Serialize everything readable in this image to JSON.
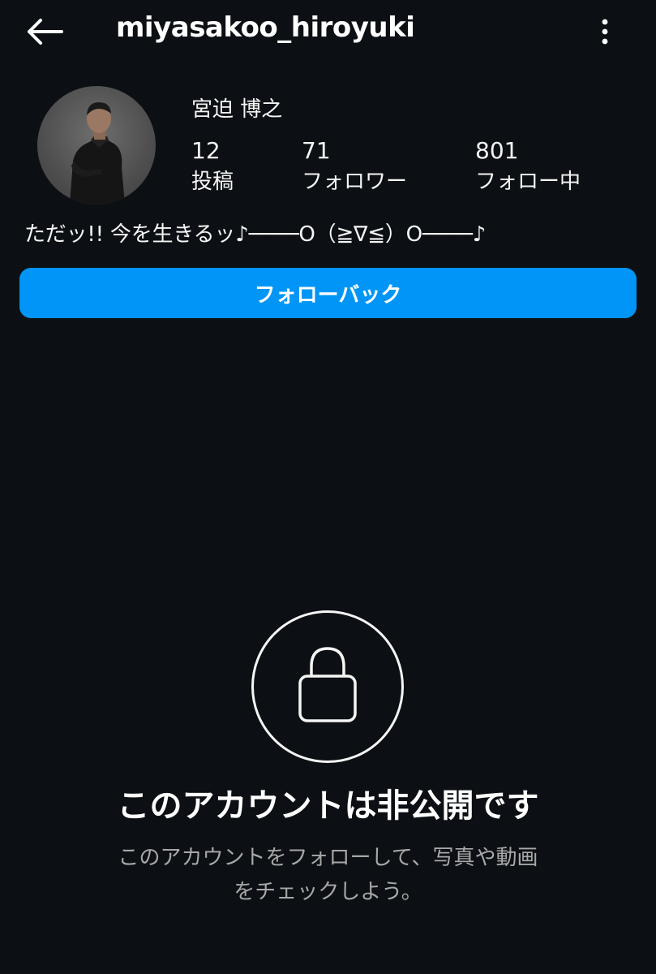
{
  "header": {
    "username": "miyasakoo_hiroyuki",
    "back_icon": "arrow-left-icon",
    "more_icon": "more-vertical-icon"
  },
  "profile": {
    "display_name": "宮迫 博之",
    "stats": {
      "posts": {
        "value": "12",
        "label": "投稿"
      },
      "followers": {
        "value": "71",
        "label": "フォロワー"
      },
      "following": {
        "value": "801",
        "label": "フォロー中"
      }
    },
    "bio": "ただッ!! 今を生きるッ♪────O（≧∇≦）O────♪"
  },
  "actions": {
    "follow_back_label": "フォローバック"
  },
  "private_notice": {
    "icon": "lock-icon",
    "title": "このアカウントは非公開です",
    "description_line1": "このアカウントをフォローして、写真や動画",
    "description_line2": "をチェックしよう。"
  },
  "colors": {
    "background": "#0c1014",
    "button": "#0095f6",
    "secondary_text": "#a8a8a8"
  }
}
